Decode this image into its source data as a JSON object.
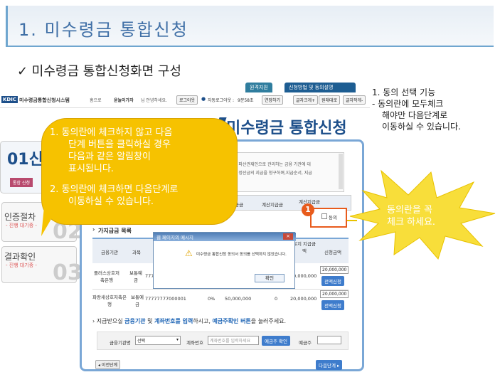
{
  "slide": {
    "title": "1. 미수령금 통합신청",
    "subtitle": "✓ 미수령금 통합신청화면 구성"
  },
  "site": {
    "logo_text": "KDIC",
    "name": "미수령금통합신청시스템",
    "nav_home": "홈으로",
    "user_greeting_name": "윤눌이가자",
    "user_greeting_tail": "님 안녕하세요.",
    "logout": "로그아웃",
    "auto_logout_label": "자동로그아웃 :",
    "auto_logout_time": "9분58초",
    "extend_btn": "연장하기",
    "font_plus": "글자크게+",
    "font_reset": "원래대로",
    "font_minus": "글자작게-",
    "tab_simple": "원격지원",
    "tab_guide": "신청방법 및 동의설명",
    "page_heading": "미수령금 통합신청"
  },
  "steps": [
    {
      "label": "01신",
      "sub": "",
      "action": "통합 신청"
    },
    {
      "label": "인증절차",
      "sub": "- 진행 대기중 -",
      "num": "02"
    },
    {
      "label": "결과확인",
      "sub": "- 진행 대기중 -",
      "num": "03"
    }
  ],
  "consent": {
    "text_line1": "가 파산관재인으로 관리하는 금융 기관에 대",
    "text_line2": "및 정산금의 지급을 청구하며,지급순서, 지급",
    "col_a": "금금",
    "col_b": "계산지급금",
    "col_c": "계산지급금",
    "checkbox_label": "동의",
    "badge": "1"
  },
  "list": {
    "title": "가지급금 목록",
    "headers": [
      "금융기관",
      "과목",
      "잔액",
      "유지 지급금액",
      "신청금액"
    ],
    "rows": [
      {
        "bank": "플러스상호저축은행",
        "type": "보통예금",
        "acct": "777",
        "pct": "",
        "amt": "",
        "calc": "20,000,000",
        "input": "20,000,000",
        "btn": "전액신청"
      },
      {
        "bank": "파랑새상호저축은행",
        "type": "보통예금",
        "acct": "77777777000001",
        "pct": "0%",
        "amt": "50,000,000",
        "calc": "0",
        "calc2": "20,000,000",
        "input": "20,000,000",
        "btn": "전액신청"
      }
    ]
  },
  "deposit": {
    "instruction_a": "지급받으실 ",
    "instruction_b": "금융기관",
    "instruction_c": " 및 ",
    "instruction_d": "계좌번호를 입력",
    "instruction_e": "하시고, ",
    "instruction_f": "예금주확인 버튼",
    "instruction_g": "을 눌러주세요.",
    "bank_label": "금융기관명",
    "bank_select": "선택",
    "acct_label": "계좌번호",
    "acct_placeholder": "계좌번호를 입력하세요",
    "verify_btn": "예금주 확인",
    "owner_label": "예금주"
  },
  "nav": {
    "prev": "◂ 이전단계",
    "next": "다음단계 ▸"
  },
  "dialog": {
    "title": "웹 페이지의 메시지",
    "message": "미수령금 통합신청 동의서 동의를 선택하지 않았습니다.",
    "ok": "확인"
  },
  "callout": {
    "item1": "1.  동의란에 체크하지 않고 다음",
    "item1b": "단계 버튼을 클릭하실 경우",
    "item1c": "다음과 같은 알림창이",
    "item1d": "표시됩니다.",
    "item2": "2.  동의란에 체크하면 다음단계로",
    "item2b": "이동하실 수 있습니다."
  },
  "note": {
    "title": "1. 동의 선택 기능",
    "line1": "-  동의란에 모두체크",
    "line2": "해야만 다음단계로",
    "line3": "이동하실 수 있습니다."
  },
  "star": {
    "line1": "동의란을 꼭",
    "line2": "체크 하세요."
  },
  "colors": {
    "accent": "#3f6fa6",
    "callout": "#f6c200",
    "star": "#f8de3a",
    "badge": "#e85b1c"
  }
}
